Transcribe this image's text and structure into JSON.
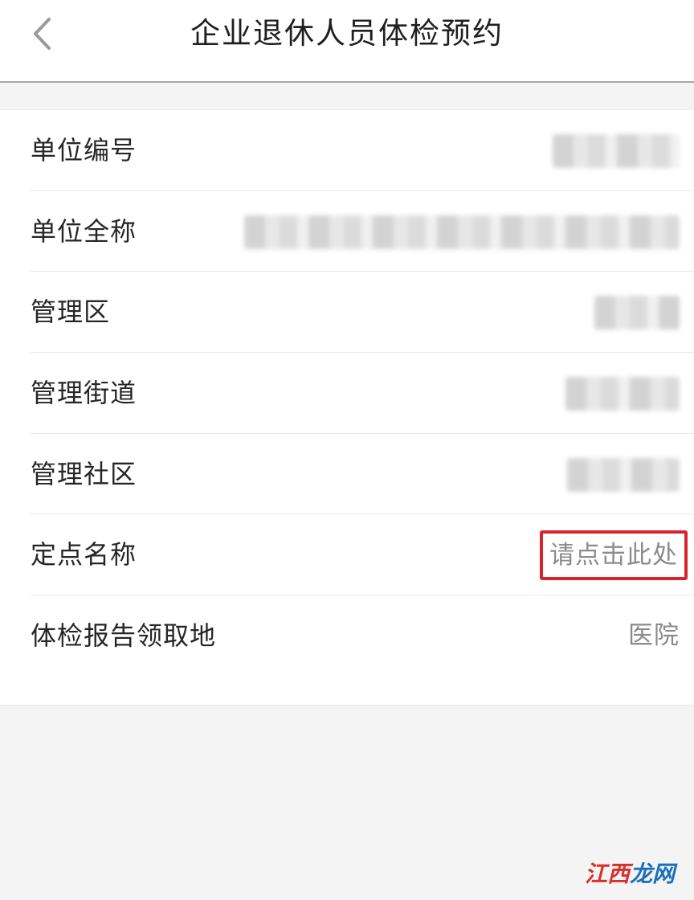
{
  "header": {
    "title": "企业退休人员体检预约",
    "back_icon": "chevron-left-icon"
  },
  "form": {
    "rows": [
      {
        "label": "单位编号"
      },
      {
        "label": "单位全称"
      },
      {
        "label": "管理区"
      },
      {
        "label": "管理街道"
      },
      {
        "label": "管理社区"
      },
      {
        "label": "定点名称",
        "value": "请点击此处"
      },
      {
        "label": "体检报告领取地",
        "value": "医院"
      }
    ]
  },
  "watermark": {
    "part1": "江西",
    "part2": "龙网"
  },
  "colors": {
    "highlight_border": "#d8242f",
    "accent_green": "#6cc283"
  }
}
